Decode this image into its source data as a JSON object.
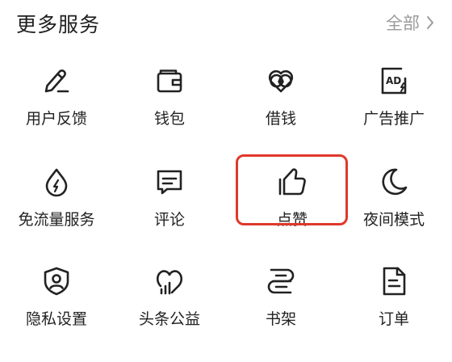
{
  "header": {
    "title": "更多服务",
    "all_label": "全部"
  },
  "colors": {
    "highlight": "#e0382c",
    "text": "#222222",
    "muted": "#9b9b9b"
  },
  "services": [
    {
      "label": "用户反馈",
      "icon": "pen-feedback-icon"
    },
    {
      "label": "钱包",
      "icon": "wallet-icon"
    },
    {
      "label": "借钱",
      "icon": "loan-heart-icon"
    },
    {
      "label": "广告推广",
      "icon": "ad-promo-icon"
    },
    {
      "label": "免流量服务",
      "icon": "data-drop-icon"
    },
    {
      "label": "评论",
      "icon": "comment-icon"
    },
    {
      "label": "点赞",
      "icon": "thumbs-up-icon",
      "highlighted": true
    },
    {
      "label": "夜间模式",
      "icon": "moon-icon"
    },
    {
      "label": "隐私设置",
      "icon": "privacy-shield-icon"
    },
    {
      "label": "头条公益",
      "icon": "charity-heart-icon"
    },
    {
      "label": "书架",
      "icon": "bookshelf-icon"
    },
    {
      "label": "订单",
      "icon": "order-document-icon"
    }
  ]
}
